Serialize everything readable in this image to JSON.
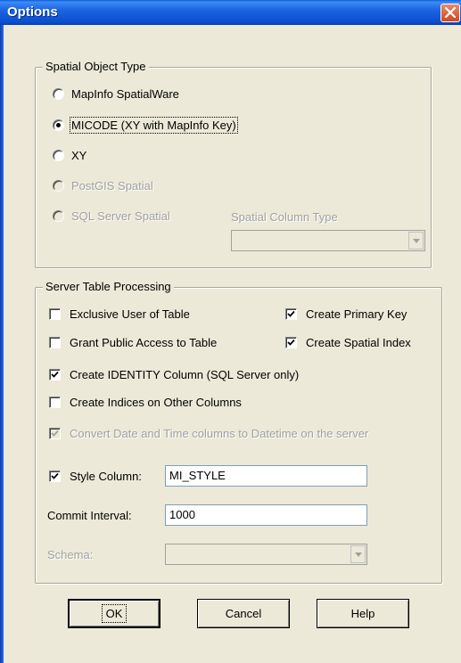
{
  "window": {
    "title": "Options"
  },
  "spatial_object_type": {
    "group_title": "Spatial Object Type",
    "options": [
      {
        "label": "MapInfo SpatialWare",
        "selected": false,
        "enabled": true
      },
      {
        "label": "MICODE (XY with MapInfo Key)",
        "selected": true,
        "enabled": true
      },
      {
        "label": "XY",
        "selected": false,
        "enabled": true
      },
      {
        "label": "PostGIS Spatial",
        "selected": false,
        "enabled": false
      },
      {
        "label": "SQL Server Spatial",
        "selected": false,
        "enabled": false
      }
    ],
    "spatial_column_type": {
      "label": "Spatial Column Type",
      "value": "",
      "enabled": false
    }
  },
  "server_table_processing": {
    "group_title": "Server Table Processing",
    "checkboxes": {
      "exclusive_user": {
        "label": "Exclusive User of Table",
        "checked": false
      },
      "create_primary_key": {
        "label": "Create Primary Key",
        "checked": true
      },
      "grant_public_access": {
        "label": "Grant Public Access to Table",
        "checked": false
      },
      "create_spatial_index": {
        "label": "Create Spatial Index",
        "checked": true
      },
      "create_identity_column": {
        "label": "Create IDENTITY Column (SQL Server only)",
        "checked": true
      },
      "create_indices_other": {
        "label": "Create Indices on Other Columns",
        "checked": false
      },
      "convert_datetime": {
        "label": "Convert Date and Time columns to Datetime on the server",
        "checked": true,
        "enabled": false
      },
      "style_column": {
        "label": "Style Column:",
        "checked": true
      }
    },
    "style_column_value": "MI_STYLE",
    "commit_interval": {
      "label": "Commit Interval:",
      "value": "1000"
    },
    "schema": {
      "label": "Schema:",
      "value": "",
      "enabled": false
    }
  },
  "buttons": {
    "ok": "OK",
    "cancel": "Cancel",
    "help": "Help"
  }
}
